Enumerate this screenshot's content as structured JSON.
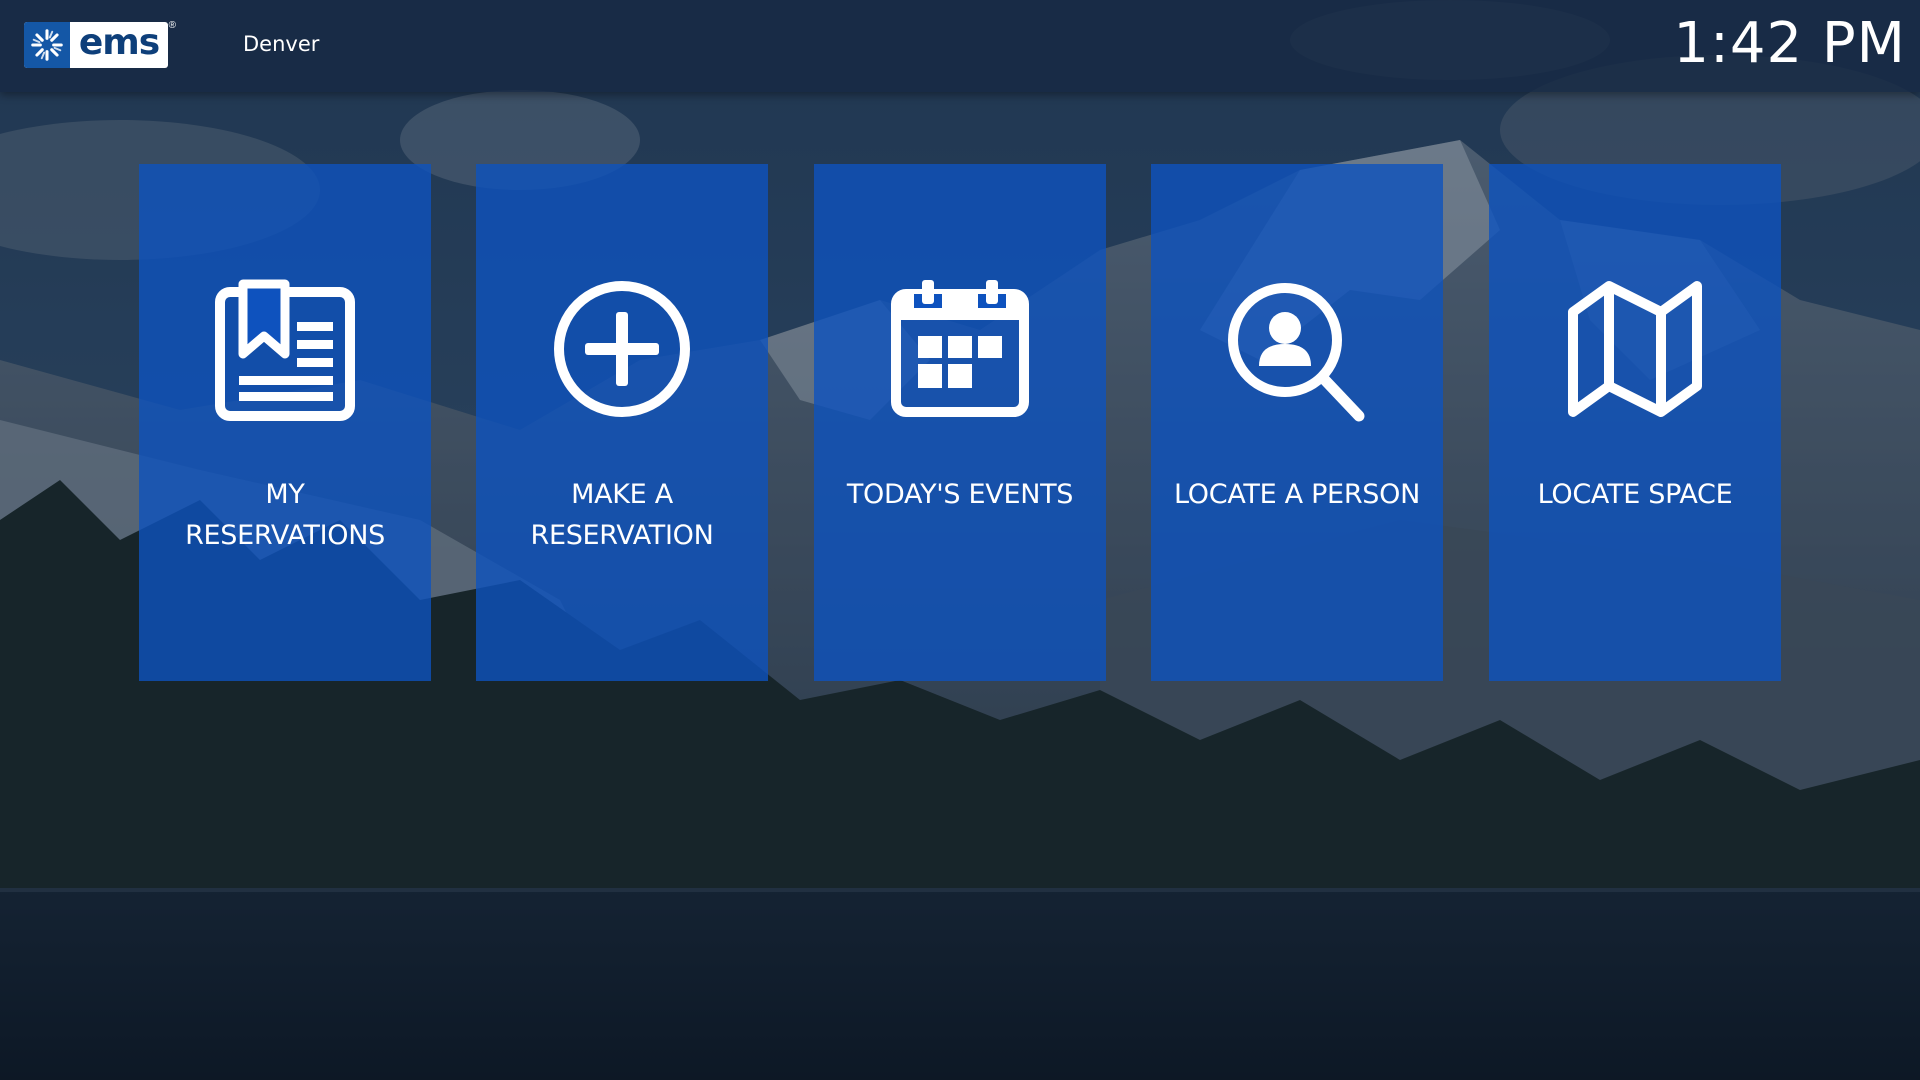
{
  "header": {
    "logo_text": "ems",
    "logo_registered": "®",
    "location": "Denver",
    "time": "1:42 PM"
  },
  "tiles": [
    {
      "label": "MY\nRESERVATIONS",
      "icon": "reservation-list-icon"
    },
    {
      "label": "MAKE A\nRESERVATION",
      "icon": "plus-circle-icon"
    },
    {
      "label": "TODAY'S EVENTS",
      "icon": "calendar-icon"
    },
    {
      "label": "LOCATE A PERSON",
      "icon": "person-search-icon"
    },
    {
      "label": "LOCATE SPACE",
      "icon": "folded-map-icon"
    }
  ],
  "colors": {
    "tile_blue": "#0e52be",
    "topbar": "#162842",
    "brand_blue": "#1457a6",
    "text": "#ffffff"
  }
}
